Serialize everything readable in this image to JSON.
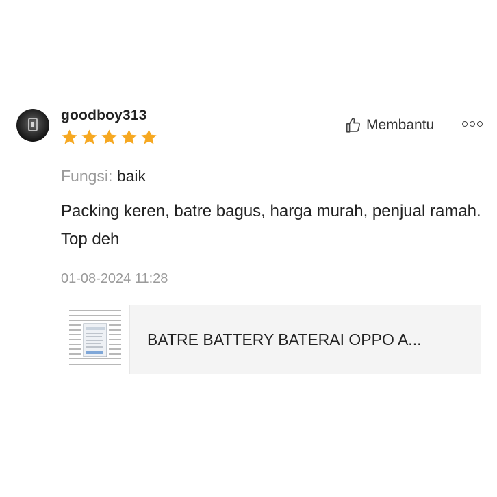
{
  "review": {
    "username": "goodboy313",
    "rating": 5,
    "helpful_label": "Membantu",
    "attribute": {
      "key": "Fungsi:",
      "value": "baik"
    },
    "comment": "Packing keren, batre bagus, harga murah, penjual ramah. Top deh",
    "timestamp": "01-08-2024 11:28",
    "product": {
      "title": "BATRE BATTERY BATERAI OPPO A..."
    },
    "colors": {
      "star": "#f6a821",
      "muted": "#9b9b9b",
      "text": "#222222",
      "card_bg": "#f4f4f4"
    },
    "icons": [
      "avatar",
      "star-icon",
      "thumbs-up-icon",
      "more-options-icon",
      "product-thumbnail"
    ]
  }
}
